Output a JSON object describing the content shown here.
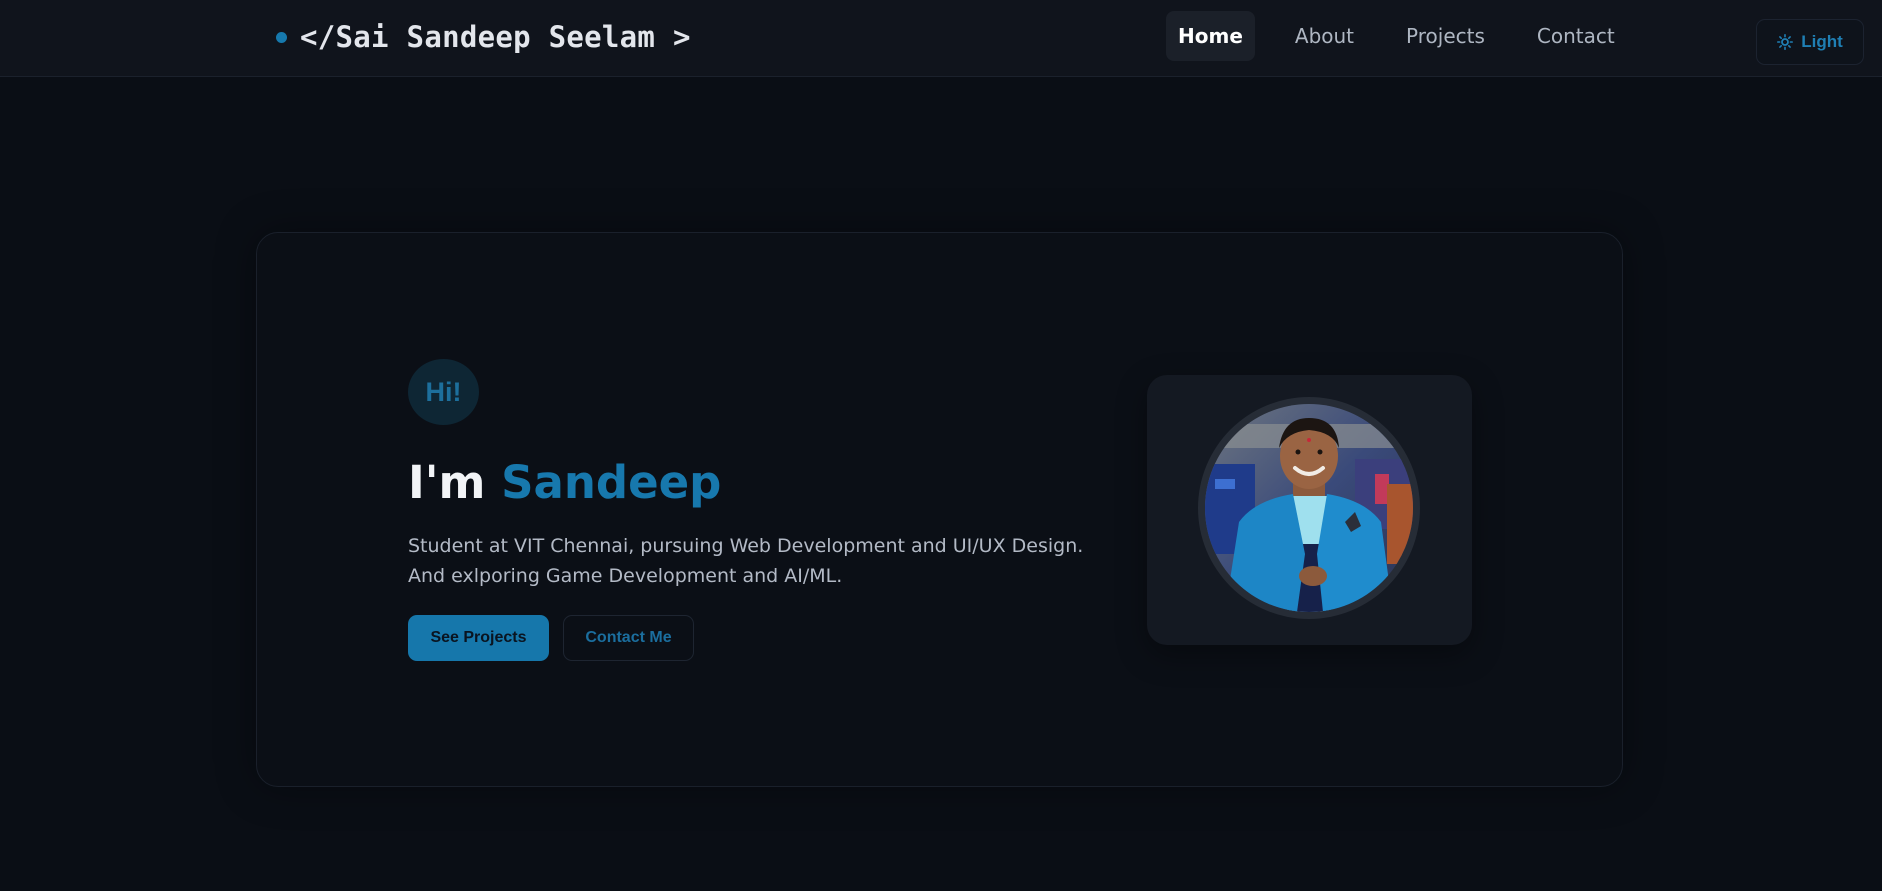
{
  "header": {
    "brand": "</Sai Sandeep Seelam >",
    "nav": [
      "Home",
      "About",
      "Projects",
      "Contact"
    ],
    "active_nav": "Home",
    "theme_toggle_label": "Light"
  },
  "hero": {
    "greeting": "Hi!",
    "headline_prefix": "I'm ",
    "headline_name": "Sandeep",
    "tagline": "Student at VIT Chennai, pursuing Web Development and UI/UX Design. And exlporing Game Development and AI/ML.",
    "primary_button": "See Projects",
    "secondary_button": "Contact Me"
  },
  "colors": {
    "background": "#0a0e15",
    "accent": "#1778ad",
    "card": "#141922"
  },
  "icons": {
    "theme": "sun-icon",
    "brand_marker": "status-dot"
  }
}
